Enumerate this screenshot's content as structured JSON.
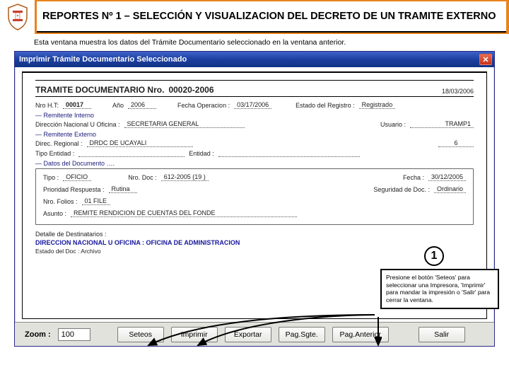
{
  "header": {
    "title_line": "REPORTES Nº 1 – SELECCIÓN Y VISUALIZACION DEL DECRETO DE UN TRAMITE EXTERNO"
  },
  "intro": "Esta ventana muestra los datos del Trámite Documentario  seleccionado en la ventana anterior.",
  "window": {
    "title": "Imprimir Trámite Documentario Seleccionado"
  },
  "doc": {
    "title_prefix": "TRAMITE  DOCUMENTARIO  Nro.",
    "nro": "00020-2006",
    "fecha_cab": "18/03/2006",
    "nro_ht_lbl": "Nro H.T:",
    "nro_ht": "00017",
    "anio_lbl": "Año",
    "anio": "2006",
    "fecha_op_lbl": "Fecha Operacion :",
    "fecha_op": "03/17/2006",
    "estado_lbl": "Estado del Registro :",
    "estado": "Registrado",
    "rem_int_lbl": "— Remitente Interno",
    "dir_nac_lbl": "Dirección Nacional U Oficina :",
    "dir_nac": "SECRETARIA GENERAL",
    "usuario_lbl": "Usuario :",
    "usuario": "TRAMP1",
    "rem_ext_lbl": "— Remitente Externo",
    "dir_reg_lbl": "Direc. Regional :",
    "dir_reg": "DRDC DE UCAYALI",
    "dir_reg_num": "6",
    "tipo_ent_lbl": "Tipo Entidad :",
    "entidad_lbl": "Entidad :",
    "datos_doc_lbl": "— Datos del Documento ….",
    "tipo_lbl": "Tipo :",
    "tipo": "OFICIO",
    "nro_doc_lbl": "Nro. Doc :",
    "nro_doc": "612-2005 (19 )",
    "fecha_doc_lbl": "Fecha :",
    "fecha_doc": "30/12/2005",
    "prio_lbl": "Prioridad Respuesta :",
    "prio": "Rutina",
    "seg_lbl": "Seguridad de Doc. :",
    "seg": "Ordinario",
    "folios_lbl": "Nro. Folios :",
    "folios": "01 FILE",
    "asunto_lbl": "Asunto :",
    "asunto": "REMITE RENDICION DE CUENTAS DEL FONDE",
    "dest_title": "Detalle de Destinatarios :",
    "dest_line": "DIRECCION NACIONAL U OFICINA : OFICINA DE ADMINISTRACION",
    "dest_sub_lbl": "Estado del Doc :",
    "dest_sub_val": "Archivo"
  },
  "toolbar": {
    "zoom_lbl": "Zoom  :",
    "zoom_val": "100",
    "seteos": "Seteos",
    "imprimir": "Imprimir",
    "exportar": "Exportar",
    "pag_sgte": "Pag.Sgte.",
    "pag_ant": "Pag.Anterior",
    "salir": "Salir"
  },
  "callout": {
    "num": "1",
    "text": "Presione el botón 'Seteos' para seleccionar una Impresora, 'Imprimir' para mandar la impresión o 'Salir' para cerrar la ventana."
  }
}
